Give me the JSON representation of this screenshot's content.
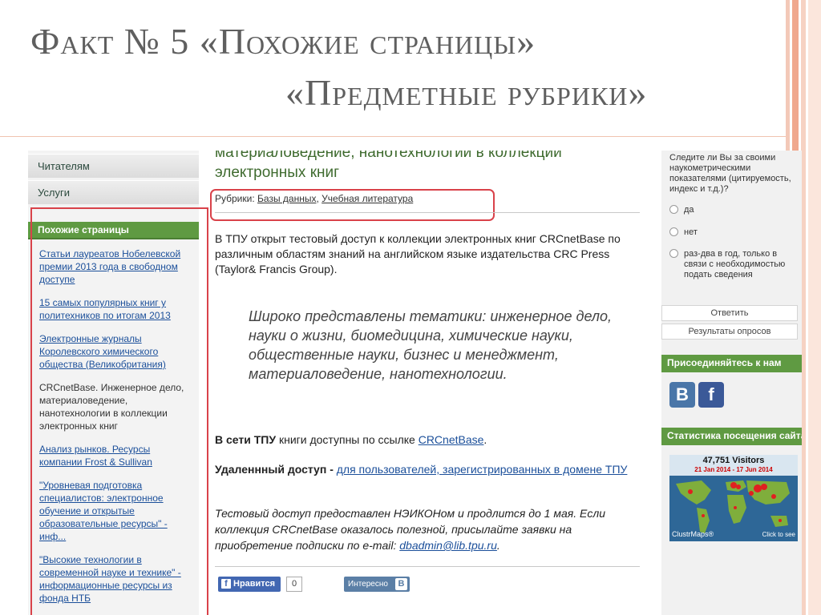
{
  "slide": {
    "title_line1": "Факт № 5 «Похожие страницы»",
    "title_line2": "«Предметные рубрики»"
  },
  "left_sidebar": {
    "menu": [
      "Читателям",
      "Услуги"
    ],
    "similar_pages_heading": "Похожие страницы",
    "similar_links": [
      "Статьи лауреатов Нобелевской премии 2013 года в свободном доступе",
      "15 самых популярных книг у политехников по итогам 2013",
      "Электронные журналы Королевского химического общества (Великобритания)",
      "CRCnetBase. Инженерное дело, материаловедение, нанотехнологии в коллекции электронных книг",
      "Анализ рынков. Ресурсы компании Frost & Sullivan",
      "\"Уровневая подготовка специалистов: электронное обучение и открытые образовательные ресурсы\" - инф...",
      "\"Высокие технологии в современной науке и технике\" - информационные ресурсы из фонда НТБ"
    ]
  },
  "main": {
    "title": "материаловедение, нанотехнологии в коллекции электронных книг",
    "rubrics_label": "Рубрики:",
    "rubric_1": "Базы данных",
    "rubric_sep": ",",
    "rubric_2": "Учебная литература",
    "intro": "В ТПУ открыт тестовый доступ к коллекции электронных книг CRCnetBase по различным областям знаний на английском языке издательства CRC Press (Taylor& Francis Group).",
    "quote": "Широко представлены тематики: инженерное дело, науки о жизни, биомедицина, химические науки, общественные науки, бизнес и менеджмент, материаловедение, нанотехнологии.",
    "net_bold": "В сети ТПУ",
    "net_text": "книги доступны по ссылке",
    "net_link": "CRCnetBase",
    "net_end": ".",
    "remote_bold": "Удаленнный доступ -",
    "remote_link": "для пользователей, зарегистрированных в домене ТПУ",
    "test_text": "Тестовый доступ предоставлен НЭИКОНом и продлится до 1 мая. Если коллекция CRCnetBase оказалось полезной, присылайте заявки на приобретение подписки по e-mail:",
    "test_email": "dbadmin@lib.tpu.ru",
    "test_end": ".",
    "fb_like_label": "Нравится",
    "fb_icon": "f",
    "fb_count": "0",
    "vk_like_label": "Интересно",
    "vk_icon": "B"
  },
  "right_sidebar": {
    "poll_question": "Следите ли Вы за своими наукометрическими показателями (цитируемость, индекс и т.д.)?",
    "options": [
      "да",
      "нет",
      "раз-два в год, только в связи с необходимостью подать сведения"
    ],
    "answer_button": "Ответить",
    "results_button": "Результаты опросов",
    "join_heading": "Присоединяйтесь к нам",
    "vk_icon": "B",
    "fb_icon": "f",
    "stats_heading": "Статистика посещения сайта",
    "map_visitors": "47,751 Visitors",
    "map_range": "21 Jan 2014 - 17 Jun 2014",
    "map_logo": "ClustrMaps®",
    "map_click": "Click to see"
  }
}
